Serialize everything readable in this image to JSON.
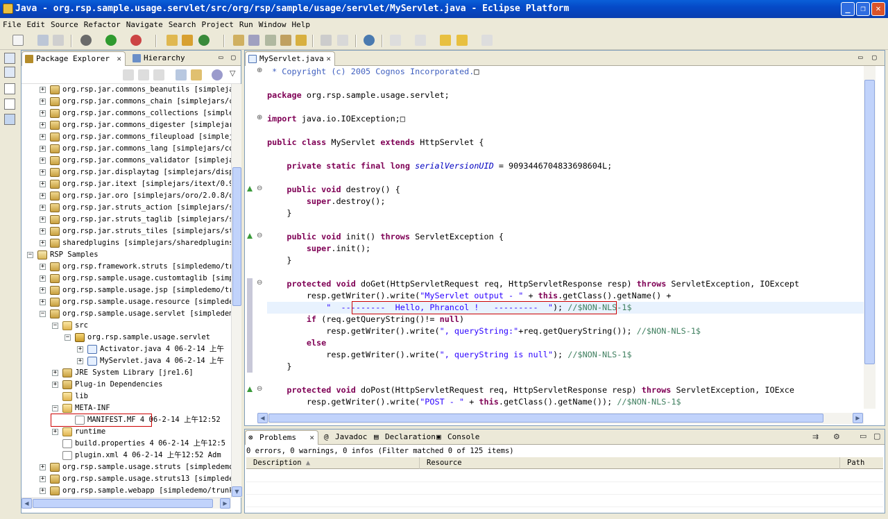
{
  "window": {
    "title": "Java - org.rsp.sample.usage.servlet/src/org/rsp/sample/usage/servlet/MyServlet.java - Eclipse Platform",
    "min": "_",
    "max": "❐",
    "close": "✕"
  },
  "menu": [
    "File",
    "Edit",
    "Source",
    "Refactor",
    "Navigate",
    "Search",
    "Project",
    "Run",
    "Window",
    "Help"
  ],
  "package_explorer": {
    "tab_label": "Package Explorer",
    "hierarchy_tab": "Hierarchy",
    "close_glyph": "✕",
    "minimize": "▭",
    "maximize": "▢",
    "tree": [
      {
        "indent": 0,
        "exp": "+",
        "icon": "jar",
        "text": "org.rsp.jar.commons_beanutils [simplejar"
      },
      {
        "indent": 0,
        "exp": "+",
        "icon": "jar",
        "text": "org.rsp.jar.commons_chain [simplejars/co"
      },
      {
        "indent": 0,
        "exp": "+",
        "icon": "jar",
        "text": "org.rsp.jar.commons_collections [simple_"
      },
      {
        "indent": 0,
        "exp": "+",
        "icon": "jar",
        "text": "org.rsp.jar.commons_digester [simplejars"
      },
      {
        "indent": 0,
        "exp": "+",
        "icon": "jar",
        "text": "org.rsp.jar.commons_fileupload [simplej"
      },
      {
        "indent": 0,
        "exp": "+",
        "icon": "jar",
        "text": "org.rsp.jar.commons_lang [simplejars/cor"
      },
      {
        "indent": 0,
        "exp": "+",
        "icon": "jar",
        "text": "org.rsp.jar.commons_validator [simplejar"
      },
      {
        "indent": 0,
        "exp": "+",
        "icon": "jar",
        "text": "org.rsp.jar.displaytag [simplejars/disp"
      },
      {
        "indent": 0,
        "exp": "+",
        "icon": "jar",
        "text": "org.rsp.jar.itext [simplejars/itext/0.99"
      },
      {
        "indent": 0,
        "exp": "+",
        "icon": "jar",
        "text": "org.rsp.jar.oro [simplejars/oro/2.0.8/or"
      },
      {
        "indent": 0,
        "exp": "+",
        "icon": "jar",
        "text": "org.rsp.jar.struts_action [simplejars/st"
      },
      {
        "indent": 0,
        "exp": "+",
        "icon": "jar",
        "text": "org.rsp.jar.struts_taglib [simplejars/st"
      },
      {
        "indent": 0,
        "exp": "+",
        "icon": "jar",
        "text": "org.rsp.jar.struts_tiles [simplejars/str"
      },
      {
        "indent": 0,
        "exp": "+",
        "icon": "jar",
        "text": "sharedplugins [simplejars/sharedplugins]"
      },
      {
        "indent": -1,
        "exp": "−",
        "icon": "proj",
        "text": "RSP Samples"
      },
      {
        "indent": 0,
        "exp": "+",
        "icon": "jar",
        "text": "org.rsp.framework.struts [simpledemo/tru"
      },
      {
        "indent": 0,
        "exp": "+",
        "icon": "jar",
        "text": "org.rsp.sample.usage.customtaglib [simp"
      },
      {
        "indent": 0,
        "exp": "+",
        "icon": "jar",
        "text": "org.rsp.sample.usage.jsp [simpledemo/tru"
      },
      {
        "indent": 0,
        "exp": "+",
        "icon": "jar",
        "text": "org.rsp.sample.usage.resource [simpledem"
      },
      {
        "indent": 0,
        "exp": "−",
        "icon": "jar",
        "text": "org.rsp.sample.usage.servlet [simpledemo"
      },
      {
        "indent": 1,
        "exp": "−",
        "icon": "folder",
        "text": "src"
      },
      {
        "indent": 2,
        "exp": "−",
        "icon": "pkg",
        "text": "org.rsp.sample.usage.servlet"
      },
      {
        "indent": 3,
        "exp": "+",
        "icon": "java",
        "text": "Activator.java 4  06-2-14 上午"
      },
      {
        "indent": 3,
        "exp": "+",
        "icon": "java",
        "text": "MyServlet.java 4  06-2-14 上午"
      },
      {
        "indent": 1,
        "exp": "+",
        "icon": "jar",
        "text": "JRE System Library [jre1.6]"
      },
      {
        "indent": 1,
        "exp": "+",
        "icon": "jar",
        "text": "Plug-in Dependencies"
      },
      {
        "indent": 1,
        "exp": "",
        "icon": "folder",
        "text": "lib"
      },
      {
        "indent": 1,
        "exp": "−",
        "icon": "folder",
        "text": "META-INF"
      },
      {
        "indent": 2,
        "exp": "",
        "icon": "file",
        "text": "MANIFEST.MF 4  06-2-14 上午12:52"
      },
      {
        "indent": 1,
        "exp": "+",
        "icon": "folder",
        "text": "runtime"
      },
      {
        "indent": 1,
        "exp": "",
        "icon": "file",
        "text": "build.properties 4  06-2-14 上午12:5"
      },
      {
        "indent": 1,
        "exp": "",
        "icon": "file",
        "text": "plugin.xml 4  06-2-14 上午12:52  Adm"
      },
      {
        "indent": 0,
        "exp": "+",
        "icon": "jar",
        "text": "org.rsp.sample.usage.struts [simpledemo/"
      },
      {
        "indent": 0,
        "exp": "+",
        "icon": "jar",
        "text": "org.rsp.sample.usage.struts13 [simpleden"
      },
      {
        "indent": 0,
        "exp": "+",
        "icon": "jar",
        "text": "org.rsp.sample.webapp [simpledemo/trunk/"
      }
    ]
  },
  "editor": {
    "tab_label": "MyServlet.java",
    "close_glyph": "✕",
    "minimize": "▭",
    "maximize": "▢",
    "lines": [
      [
        {
          "c": "jd",
          "t": " * Copyright (c) 2005 Cognos Incorporated."
        },
        {
          "c": "",
          "t": "□"
        }
      ],
      [],
      [
        {
          "c": "kw",
          "t": "package"
        },
        {
          "c": "",
          "t": " org.rsp.sample.usage.servlet;"
        }
      ],
      [],
      [
        {
          "c": "kw",
          "t": "import"
        },
        {
          "c": "",
          "t": " java.io.IOException;"
        },
        {
          "c": "",
          "t": "□"
        }
      ],
      [],
      [
        {
          "c": "kw",
          "t": "public class"
        },
        {
          "c": "",
          "t": " MyServlet "
        },
        {
          "c": "kw",
          "t": "extends"
        },
        {
          "c": "",
          "t": " HttpServlet {"
        }
      ],
      [],
      [
        {
          "c": "",
          "t": "    "
        },
        {
          "c": "kw",
          "t": "private static final long"
        },
        {
          "c": "",
          "t": " "
        },
        {
          "c": "fld",
          "t": "serialVersionUID"
        },
        {
          "c": "",
          "t": " = 9093446704833698604L;"
        }
      ],
      [],
      [
        {
          "c": "",
          "t": "    "
        },
        {
          "c": "kw",
          "t": "public void"
        },
        {
          "c": "",
          "t": " destroy() {"
        }
      ],
      [
        {
          "c": "",
          "t": "        "
        },
        {
          "c": "kw",
          "t": "super"
        },
        {
          "c": "",
          "t": ".destroy();"
        }
      ],
      [
        {
          "c": "",
          "t": "    }"
        }
      ],
      [],
      [
        {
          "c": "",
          "t": "    "
        },
        {
          "c": "kw",
          "t": "public void"
        },
        {
          "c": "",
          "t": " init() "
        },
        {
          "c": "kw",
          "t": "throws"
        },
        {
          "c": "",
          "t": " ServletException {"
        }
      ],
      [
        {
          "c": "",
          "t": "        "
        },
        {
          "c": "kw",
          "t": "super"
        },
        {
          "c": "",
          "t": ".init();"
        }
      ],
      [
        {
          "c": "",
          "t": "    }"
        }
      ],
      [],
      [
        {
          "c": "",
          "t": "    "
        },
        {
          "c": "kw",
          "t": "protected void"
        },
        {
          "c": "",
          "t": " doGet(HttpServletRequest req, HttpServletResponse resp) "
        },
        {
          "c": "kw",
          "t": "throws"
        },
        {
          "c": "",
          "t": " ServletException, IOExcept"
        }
      ],
      [
        {
          "c": "",
          "t": "        resp.getWriter().write("
        },
        {
          "c": "str",
          "t": "\"MyServlet output - \""
        },
        {
          "c": "",
          "t": " + "
        },
        {
          "c": "kw",
          "t": "this"
        },
        {
          "c": "",
          "t": ".getClass().getName() +"
        }
      ],
      [
        {
          "c": "",
          "t": "            "
        },
        {
          "c": "str",
          "t": "\"  ---------  Hello, Phrancol !   ---------  \""
        },
        {
          "c": "",
          "t": "); "
        },
        {
          "c": "cm",
          "t": "//$NON-NLS-1$"
        }
      ],
      [
        {
          "c": "",
          "t": "        "
        },
        {
          "c": "kw",
          "t": "if"
        },
        {
          "c": "",
          "t": " (req.getQueryString()!= "
        },
        {
          "c": "kw",
          "t": "null"
        },
        {
          "c": "",
          "t": ")"
        }
      ],
      [
        {
          "c": "",
          "t": "            resp.getWriter().write("
        },
        {
          "c": "str",
          "t": "\", queryString:\""
        },
        {
          "c": "",
          "t": "+req.getQueryString()); "
        },
        {
          "c": "cm",
          "t": "//$NON-NLS-1$"
        }
      ],
      [
        {
          "c": "",
          "t": "        "
        },
        {
          "c": "kw",
          "t": "else"
        }
      ],
      [
        {
          "c": "",
          "t": "            resp.getWriter().write("
        },
        {
          "c": "str",
          "t": "\", queryString is null\""
        },
        {
          "c": "",
          "t": "); "
        },
        {
          "c": "cm",
          "t": "//$NON-NLS-1$"
        }
      ],
      [
        {
          "c": "",
          "t": "    }"
        }
      ],
      [],
      [
        {
          "c": "",
          "t": "    "
        },
        {
          "c": "kw",
          "t": "protected void"
        },
        {
          "c": "",
          "t": " doPost(HttpServletRequest req, HttpServletResponse resp) "
        },
        {
          "c": "kw",
          "t": "throws"
        },
        {
          "c": "",
          "t": " ServletException, IOExce"
        }
      ],
      [
        {
          "c": "",
          "t": "        resp.getWriter().write("
        },
        {
          "c": "str",
          "t": "\"POST - \""
        },
        {
          "c": "",
          "t": " + "
        },
        {
          "c": "kw",
          "t": "this"
        },
        {
          "c": "",
          "t": ".getClass().getName()); "
        },
        {
          "c": "cm",
          "t": "//$NON-NLS-1$"
        }
      ]
    ]
  },
  "problems": {
    "tabs": [
      {
        "label": "Problems",
        "glyph": "⊗",
        "close": "✕"
      },
      {
        "label": "Javadoc",
        "glyph": "@"
      },
      {
        "label": "Declaration",
        "glyph": "▤"
      },
      {
        "label": "Console",
        "glyph": "▣"
      }
    ],
    "summary": "0 errors, 0 warnings, 0 infos (Filter matched 0 of 125 items)",
    "columns": [
      "Description",
      "Resource",
      "Path"
    ],
    "sort_glyph": "▲",
    "minimize": "▭",
    "maximize": "▢"
  },
  "colors": {
    "keyword": "#7f0055",
    "string": "#2a00ff",
    "comment": "#3f7f5f",
    "javadoc": "#3f5fbf",
    "highlight_box": "#cc0000"
  }
}
